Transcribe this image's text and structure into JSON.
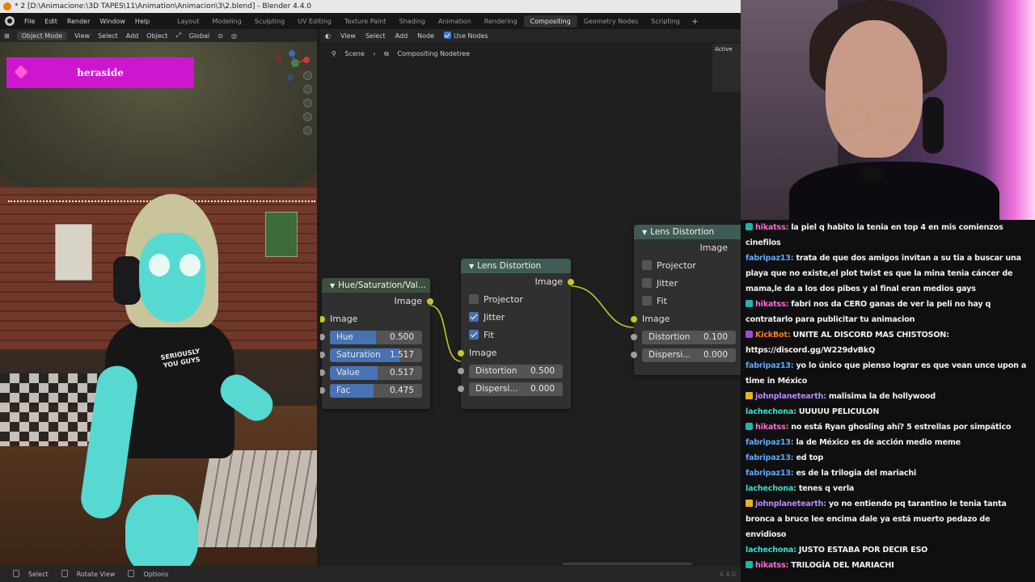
{
  "window": {
    "title": "* 2 [D:\\Animacione:\\3D TAPES\\11\\Animation\\Animacion\\3\\2.blend] - Blender 4.4.0"
  },
  "menu": {
    "items": [
      "File",
      "Edit",
      "Render",
      "Window",
      "Help"
    ]
  },
  "workspaces": {
    "tabs": [
      "Layout",
      "Modeling",
      "Sculpting",
      "UV Editing",
      "Texture Paint",
      "Shading",
      "Animation",
      "Rendering",
      "Compositing",
      "Geometry Nodes",
      "Scripting"
    ],
    "active": "Compositing",
    "add": "+"
  },
  "viewport": {
    "mode": "Object Mode",
    "menus": [
      "View",
      "Select",
      "Add",
      "Object"
    ],
    "orientation": "Global",
    "stream_name": "heraside",
    "shirt_text": "SERIOUSLY YOU GUYS"
  },
  "compositor": {
    "menus": [
      "View",
      "Select",
      "Add",
      "Node"
    ],
    "use_nodes_label": "Use Nodes",
    "breadcrumb": [
      "Scene",
      "Compositing Nodetree"
    ],
    "active_panel_label": "Active"
  },
  "nodes": {
    "hsv": {
      "title": "Hue/Saturation/Val...",
      "output": "Image",
      "input": "Image",
      "fields": [
        {
          "label": "Hue",
          "value": "0.500",
          "fill": 0.5
        },
        {
          "label": "Saturation",
          "value": "1.517",
          "fill": 0.758
        },
        {
          "label": "Value",
          "value": "0.517",
          "fill": 0.517
        },
        {
          "label": "Fac",
          "value": "0.475",
          "fill": 0.475
        }
      ]
    },
    "lens1": {
      "title": "Lens Distortion",
      "output": "Image",
      "checks": [
        {
          "label": "Projector",
          "checked": false
        },
        {
          "label": "Jitter",
          "checked": true
        },
        {
          "label": "Fit",
          "checked": true
        }
      ],
      "input": "Image",
      "fields": [
        {
          "label": "Distortion",
          "value": "0.500"
        },
        {
          "label": "Dispersi...",
          "value": "0.000"
        }
      ]
    },
    "lens2": {
      "title": "Lens Distortion",
      "output": "Image",
      "checks": [
        {
          "label": "Projector",
          "checked": false
        },
        {
          "label": "Jitter",
          "checked": false
        },
        {
          "label": "Fit",
          "checked": false
        }
      ],
      "input": "Image",
      "fields": [
        {
          "label": "Distortion",
          "value": "0.100"
        },
        {
          "label": "Dispersi...",
          "value": "0.000"
        }
      ]
    }
  },
  "statusbar": {
    "items": [
      "Select",
      "Rotate View",
      "Options"
    ],
    "version": "4.4.0"
  },
  "chat": {
    "colors": {
      "blue": "#5aa9ff",
      "magenta": "#ff6ad5",
      "cyan": "#33e0d0",
      "orange": "#ff7a1a",
      "violet": "#b68cff"
    },
    "messages": [
      {
        "badge": "teal",
        "user": "hikatss",
        "color": "magenta",
        "text": "la piel q habito la tenia en top 4 en mis comienzos cinefilos"
      },
      {
        "badge": "",
        "user": "fabripaz13",
        "color": "blue",
        "text": "trata de que dos amigos invitan a su tia a buscar una playa que no existe,el plot twist es que la mina tenia cáncer de mama,le da a los dos pibes y al final eran medios gays"
      },
      {
        "badge": "teal",
        "user": "hikatss",
        "color": "magenta",
        "text": "fabri nos da CERO ganas de ver la peli no hay q contratarlo para publicitar tu animacion"
      },
      {
        "badge": "bot",
        "user": "KickBot",
        "color": "orange",
        "text": "UNITE AL DISCORD MAS CHISTOSON: https://discord.gg/W229dvBkQ"
      },
      {
        "badge": "",
        "user": "fabripaz13",
        "color": "blue",
        "text": "yo lo único que pienso lograr es que vean unce upon a time in México"
      },
      {
        "badge": "crown",
        "user": "johnplanetearth",
        "color": "violet",
        "text": "malisima la de hollywood"
      },
      {
        "badge": "",
        "user": "lachechona",
        "color": "cyan",
        "text": "UUUUU PELICULON"
      },
      {
        "badge": "teal",
        "user": "hikatss",
        "color": "magenta",
        "text": "no está Ryan ghosling ahí? 5 estrellas por simpático"
      },
      {
        "badge": "",
        "user": "fabripaz13",
        "color": "blue",
        "text": "la de México es de acción medio meme"
      },
      {
        "badge": "",
        "user": "fabripaz13",
        "color": "blue",
        "text": "ed top"
      },
      {
        "badge": "",
        "user": "fabripaz13",
        "color": "blue",
        "text": "es de la trilogia del mariachi"
      },
      {
        "badge": "",
        "user": "lachechona",
        "color": "cyan",
        "text": "tenes q verla"
      },
      {
        "badge": "crown",
        "user": "johnplanetearth",
        "color": "violet",
        "text": "yo no entiendo pq tarantino le tenia tanta bronca a bruce lee encima dale ya está muerto pedazo de envidioso"
      },
      {
        "badge": "",
        "user": "lachechona",
        "color": "cyan",
        "text": "JUSTO ESTABA POR DECIR ESO"
      },
      {
        "badge": "teal",
        "user": "hikatss",
        "color": "magenta",
        "text": "TRILOGÍA DEL MARIACHI"
      }
    ]
  }
}
